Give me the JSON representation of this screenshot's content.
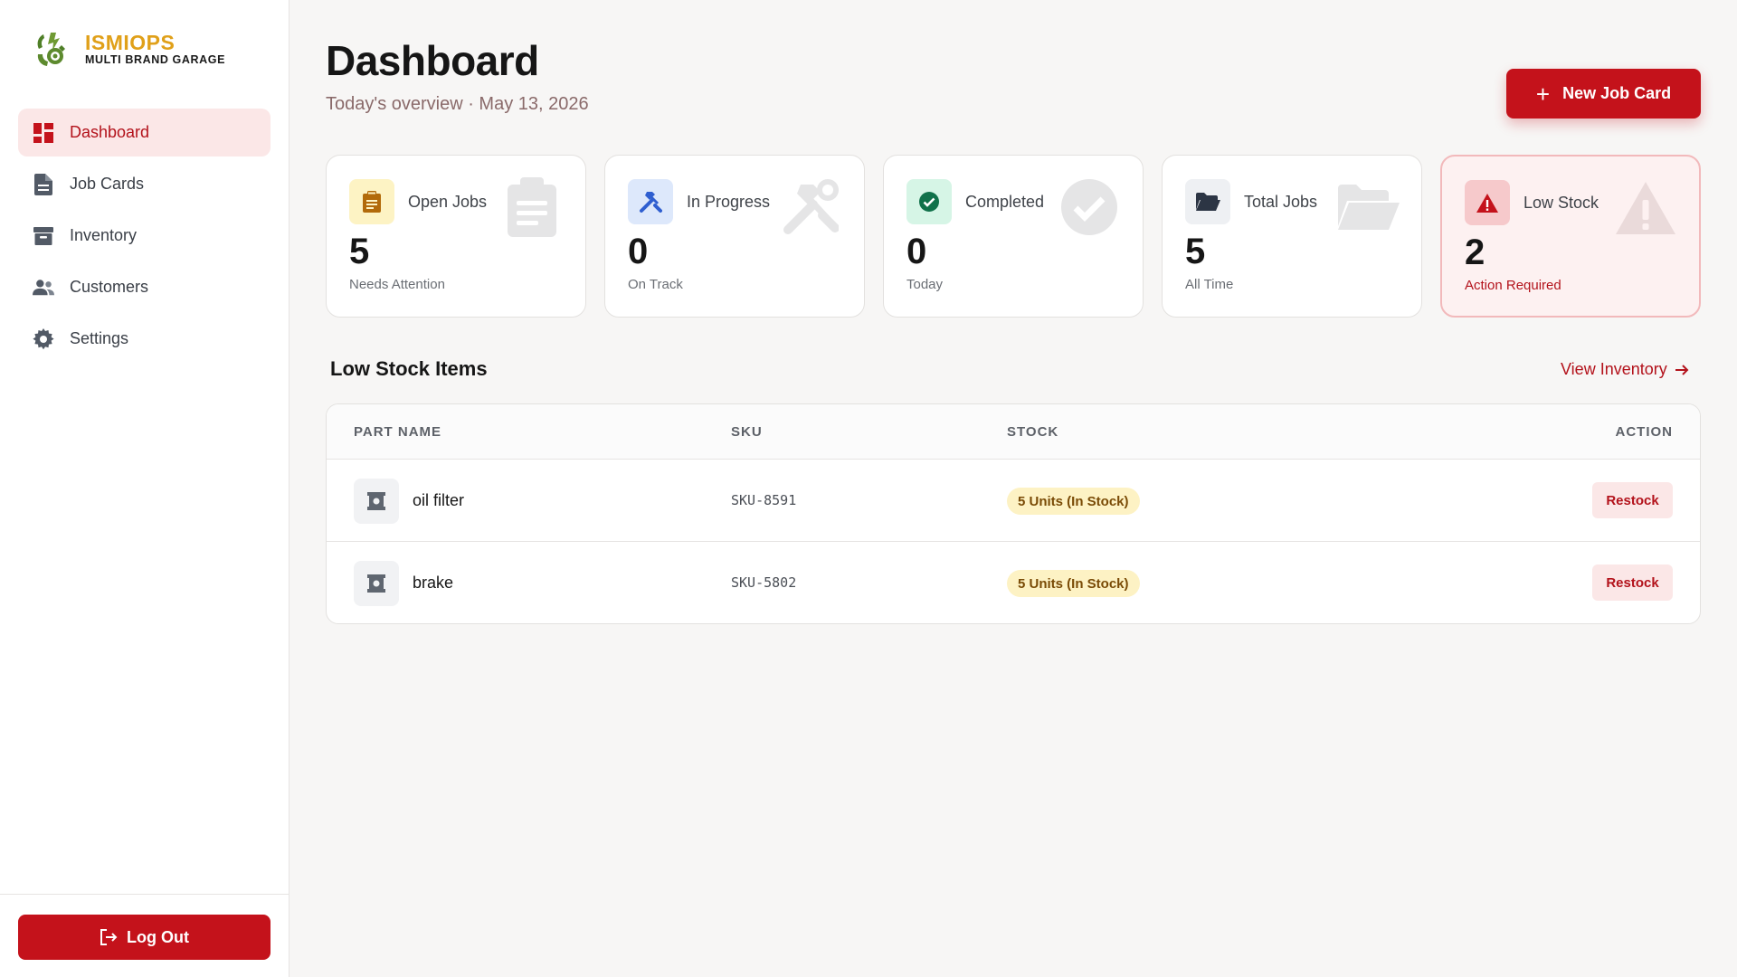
{
  "brand": {
    "name": "ISMIOPS",
    "subtitle": "MULTI BRAND GARAGE"
  },
  "sidebar": {
    "items": [
      {
        "label": "Dashboard",
        "icon": "dashboard-icon",
        "active": true
      },
      {
        "label": "Job Cards",
        "icon": "document-icon",
        "active": false
      },
      {
        "label": "Inventory",
        "icon": "archive-box-icon",
        "active": false
      },
      {
        "label": "Customers",
        "icon": "users-icon",
        "active": false
      },
      {
        "label": "Settings",
        "icon": "gear-icon",
        "active": false
      }
    ],
    "logout_label": "Log Out"
  },
  "header": {
    "title": "Dashboard",
    "subtitle": "Today's overview · May 13, 2026",
    "new_job_label": "New Job Card"
  },
  "stats": [
    {
      "label": "Open Jobs",
      "value": "5",
      "caption": "Needs Attention",
      "icon": "clipboard-icon",
      "color": "#b26a0a"
    },
    {
      "label": "In Progress",
      "value": "0",
      "caption": "On Track",
      "icon": "tools-icon",
      "color": "#2f5fd0"
    },
    {
      "label": "Completed",
      "value": "0",
      "caption": "Today",
      "icon": "check-circle-icon",
      "color": "#10714a"
    },
    {
      "label": "Total Jobs",
      "value": "5",
      "caption": "All Time",
      "icon": "folder-open-icon",
      "color": "#2c3544"
    },
    {
      "label": "Low Stock",
      "value": "2",
      "caption": "Action Required",
      "icon": "warning-icon",
      "color": "#c4121b"
    }
  ],
  "low_stock": {
    "title": "Low Stock Items",
    "view_link": "View Inventory",
    "columns": [
      "PART NAME",
      "SKU",
      "STOCK",
      "ACTION"
    ],
    "rows": [
      {
        "name": "oil filter",
        "sku": "SKU-8591",
        "stock": "5 Units (In Stock)",
        "action": "Restock"
      },
      {
        "name": "brake",
        "sku": "SKU-5802",
        "stock": "5 Units (In Stock)",
        "action": "Restock"
      }
    ]
  },
  "colors": {
    "accent": "#c4121b",
    "accent_soft": "#fbe7e7",
    "brand_gold": "#e0a019",
    "logo_green": "#5d8a2e"
  }
}
